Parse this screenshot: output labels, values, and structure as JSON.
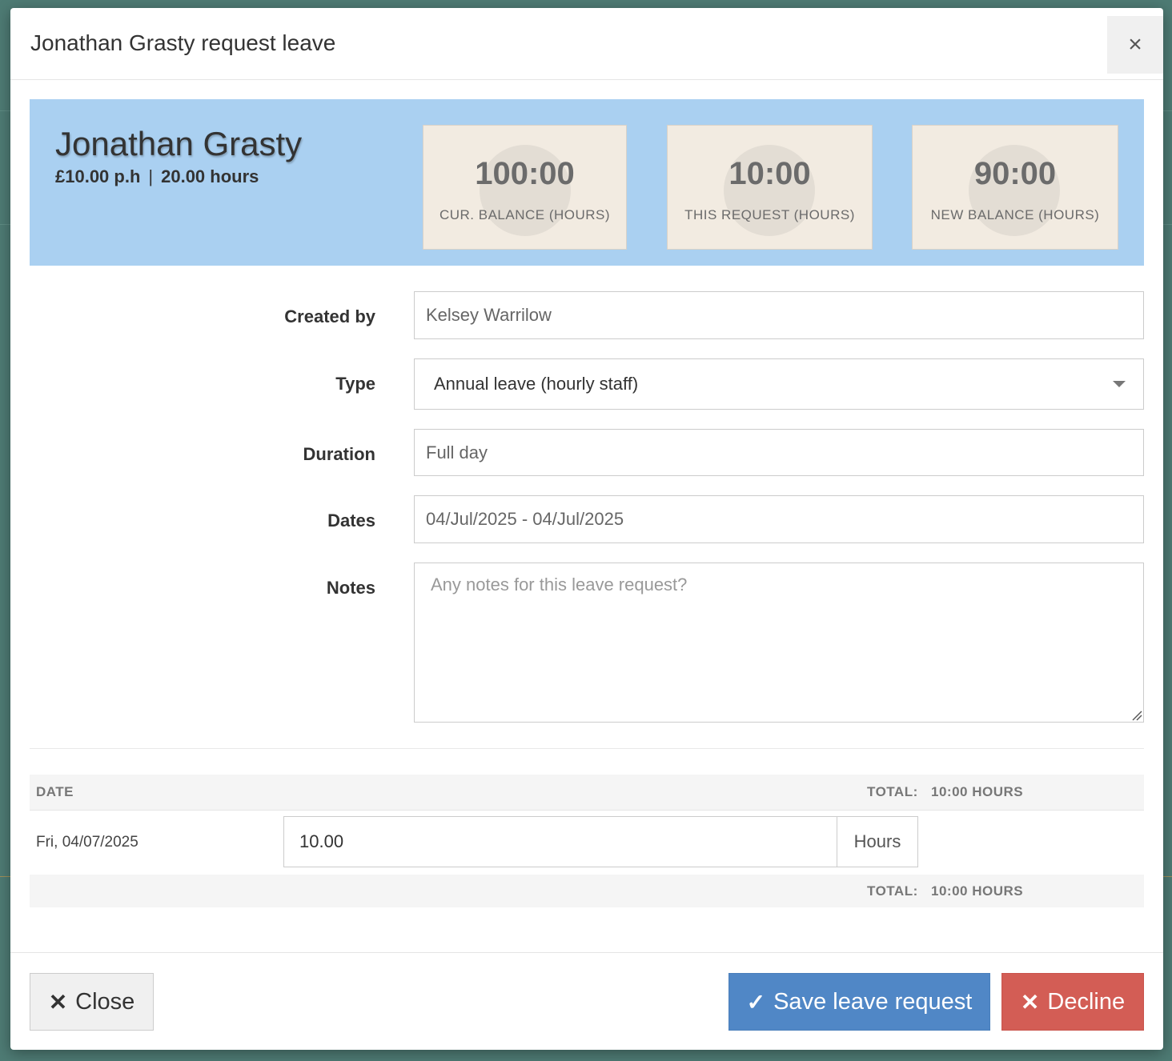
{
  "modal": {
    "title": "Jonathan Grasty request leave",
    "close_icon": "×"
  },
  "employee": {
    "name": "Jonathan Grasty",
    "rate": "£10.00 p.h",
    "separator": "|",
    "hours": "20.00 hours"
  },
  "stats": [
    {
      "value": "100:00",
      "label": "CUR. BALANCE (HOURS)"
    },
    {
      "value": "10:00",
      "label": "THIS REQUEST (HOURS)"
    },
    {
      "value": "90:00",
      "label": "NEW BALANCE (HOURS)"
    }
  ],
  "form": {
    "created_by": {
      "label": "Created by",
      "value": "Kelsey Warrilow"
    },
    "type": {
      "label": "Type",
      "value": "Annual leave (hourly staff)"
    },
    "duration": {
      "label": "Duration",
      "value": "Full day"
    },
    "dates": {
      "label": "Dates",
      "value": "04/Jul/2025 - 04/Jul/2025"
    },
    "notes": {
      "label": "Notes",
      "placeholder": "Any notes for this leave request?"
    }
  },
  "table": {
    "date_header": "DATE",
    "total_label": "TOTAL:",
    "total_value": "10:00 HOURS",
    "rows": [
      {
        "date": "Fri, 04/07/2025",
        "hours": "10.00",
        "unit": "Hours"
      }
    ]
  },
  "footer": {
    "close_label": "Close",
    "save_label": "Save leave request",
    "decline_label": "Decline"
  },
  "colors": {
    "banner": "#aad0f1",
    "save": "#5087c6",
    "decline": "#d35d55",
    "backdrop": "#4e7b74"
  }
}
